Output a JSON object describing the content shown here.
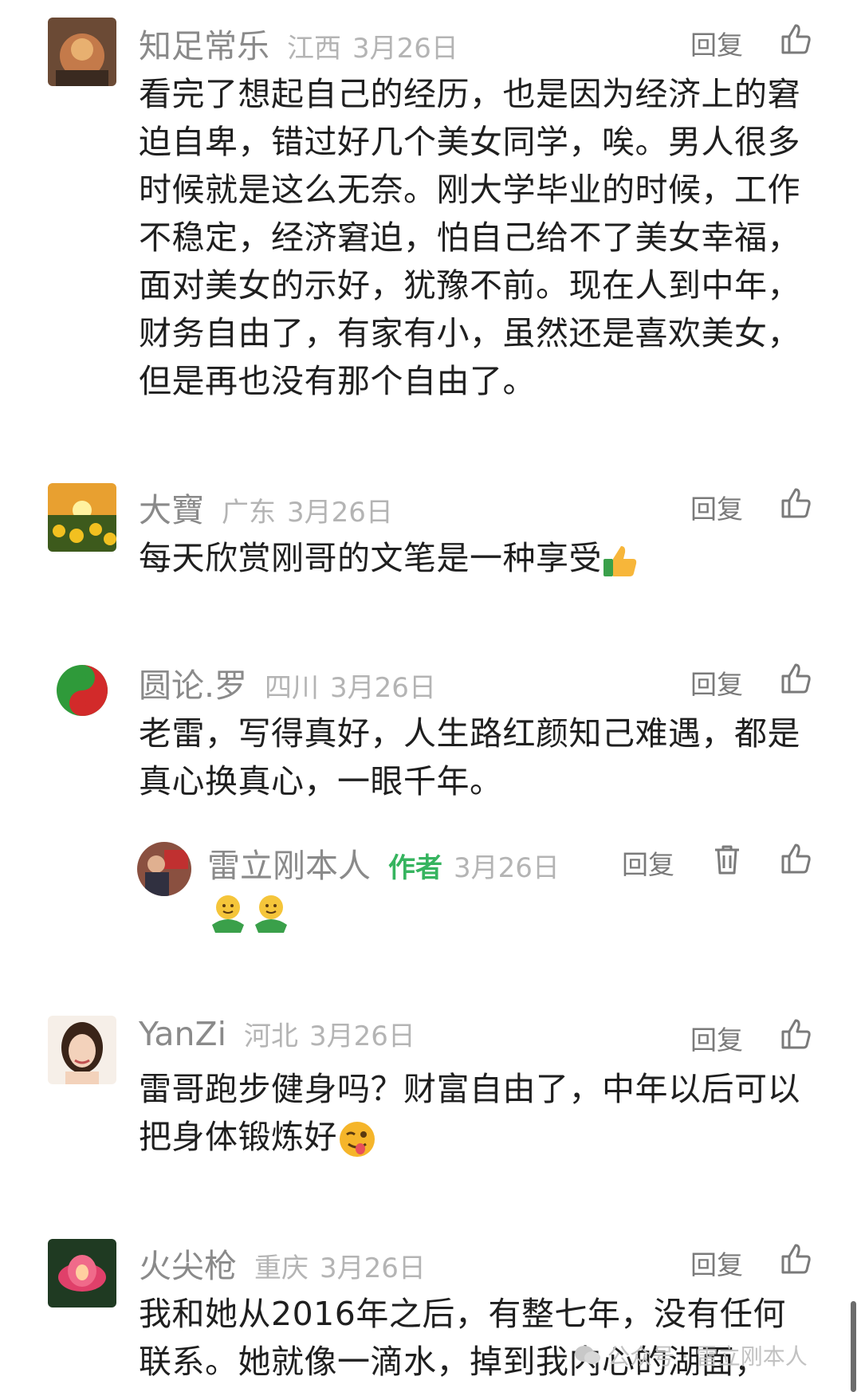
{
  "reply_label": "回复",
  "comments": [
    {
      "name": "知足常乐",
      "location": "江西",
      "date": "3月26日",
      "text": "看完了想起自己的经历，也是因为经济上的窘迫自卑，错过好几个美女同学，唉。男人很多时候就是这么无奈。刚大学毕业的时候，工作不稳定，经济窘迫，怕自己给不了美女幸福，面对美女的示好，犹豫不前。现在人到中年，财务自由了，有家有小，虽然还是喜欢美女，但是再也没有那个自由了。"
    },
    {
      "name": "大寶",
      "location": "广东",
      "date": "3月26日",
      "text": "每天欣赏刚哥的文笔是一种享受",
      "emoji": "thumbs-up-emoji"
    },
    {
      "name": "圆论.罗",
      "location": "四川",
      "date": "3月26日",
      "text": "老雷，写得真好，人生路红颜知己难遇，都是真心换真心，一眼千年。",
      "reply": {
        "name": "雷立刚本人",
        "tag": "作者",
        "date": "3月26日",
        "emoji": "hug-emoji"
      }
    },
    {
      "name": "YanZi",
      "location": "河北",
      "date": "3月26日",
      "text": "雷哥跑步健身吗？财富自由了，中年以后可以把身体锻炼好",
      "emoji": "winking-tongue-emoji"
    },
    {
      "name": "火尖枪",
      "location": "重庆",
      "date": "3月26日",
      "text": "我和她从2016年之后，有整七年，没有任何联系。她就像一滴水，掉到我内心的湖面，"
    }
  ],
  "watermark": "公众号 · 雷立刚本人",
  "colors": {
    "author_tag": "#36b45f",
    "name": "#8a8a8a",
    "meta": "#b4b4b4"
  }
}
